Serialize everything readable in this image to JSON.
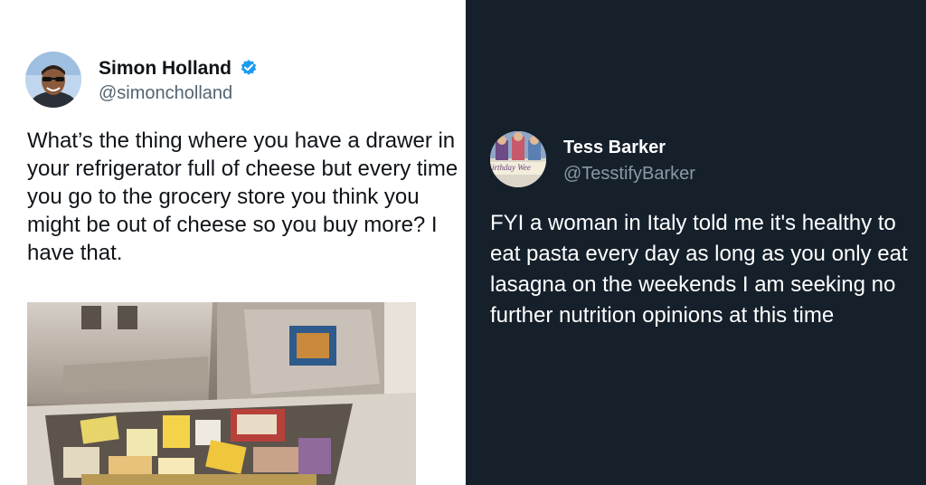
{
  "left_tweet": {
    "author_name": "Simon Holland",
    "handle": "@simoncholland",
    "verified_icon": "verified-badge-icon",
    "text": "What’s the thing where you have a drawer in your refrigerator full of cheese but every time you go to the grocery store you think you might be out of cheese so you buy more? I have that.",
    "photo": "refrigerator-drawer-full-of-cheese"
  },
  "right_tweet": {
    "author_name": "Tess Barker",
    "handle": "@TesstifyBarker",
    "avatar_caption": "irthday Wee",
    "text": "FYI a woman in Italy told me it's healthy to eat pasta every day as long as you only eat lasagna on the weekends I am seeking no further nutrition opinions at this time"
  },
  "colors": {
    "light_bg": "#ffffff",
    "dark_bg": "#15202b",
    "verified_blue": "#1d9bf0",
    "handle_light": "#536471",
    "handle_dark": "#8b98a5"
  }
}
